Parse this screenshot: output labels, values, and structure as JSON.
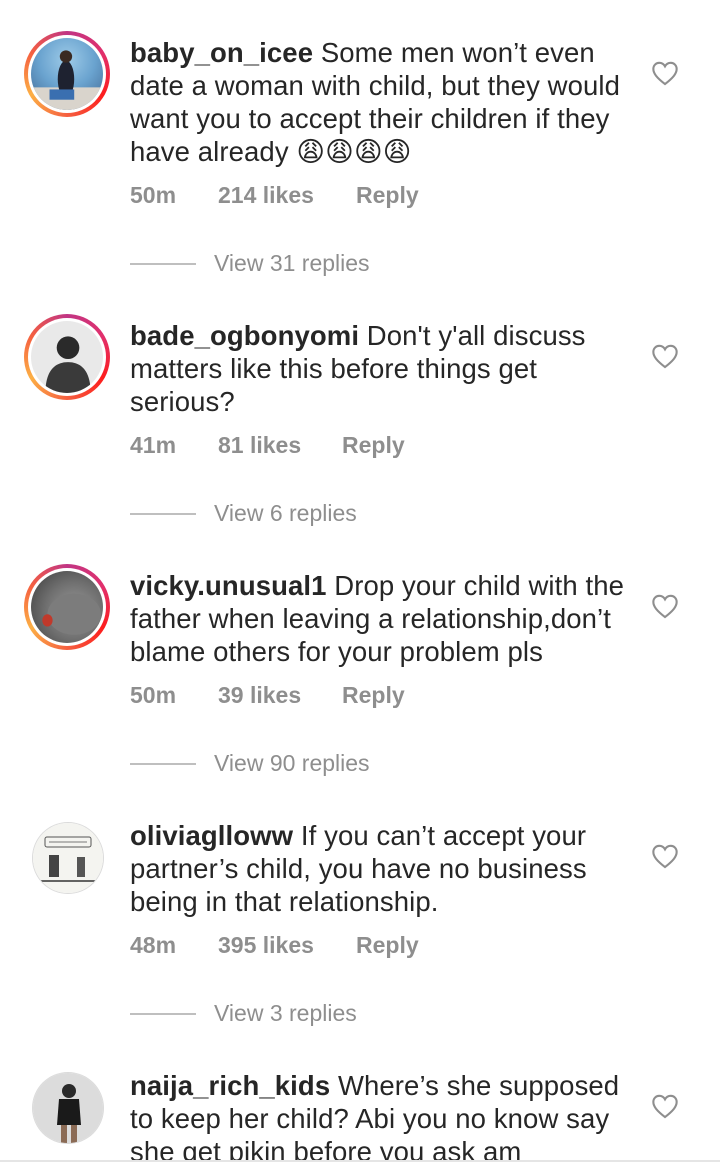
{
  "comments": [
    {
      "username": "baby_on_icee",
      "text": " Some men won’t even date a woman with child, but they would want you to accept their children if they have already 😩😩😩😩",
      "time": "50m",
      "likes": "214 likes",
      "reply": "Reply",
      "view_replies": "View 31 replies",
      "story_ring": true
    },
    {
      "username": "bade_ogbonyomi",
      "text": " Don't y'all discuss matters like this before things get serious?",
      "time": "41m",
      "likes": "81 likes",
      "reply": "Reply",
      "view_replies": "View 6 replies",
      "story_ring": true
    },
    {
      "username": "vicky.unusual1",
      "text": " Drop your child with the father when leaving a relationship,don’t blame others for your problem pls",
      "time": "50m",
      "likes": "39 likes",
      "reply": "Reply",
      "view_replies": "View 90 replies",
      "story_ring": true
    },
    {
      "username": "oliviaglloww",
      "text": " If you can’t accept your partner’s child, you have no business being in that relationship.",
      "time": "48m",
      "likes": "395 likes",
      "reply": "Reply",
      "view_replies": "View 3 replies",
      "story_ring": false
    },
    {
      "username": "naija_rich_kids",
      "text": " Where’s she supposed to keep her child? Abi you no know say she get pikin before you ask am",
      "story_ring": false
    }
  ],
  "colors": {
    "text": "#262626",
    "secondary": "#8e8e8e",
    "divider": "#bfbfbf"
  },
  "icons": {
    "like": "heart-outline-icon"
  }
}
